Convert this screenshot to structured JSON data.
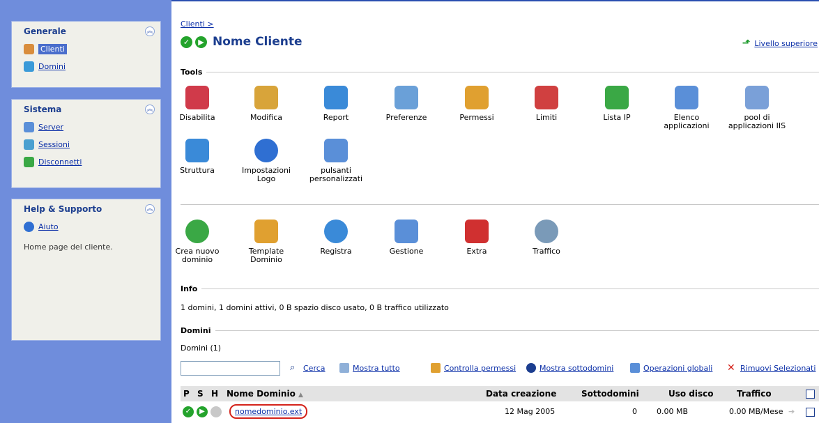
{
  "sidebar": {
    "generale": {
      "title": "Generale",
      "items": [
        {
          "label": "Clienti",
          "icon": "user-icon",
          "color": "#d98d3c"
        },
        {
          "label": "Domini",
          "icon": "domain-icon",
          "color": "#3a9ad8"
        }
      ]
    },
    "sistema": {
      "title": "Sistema",
      "items": [
        {
          "label": "Server",
          "icon": "server-icon",
          "color": "#5a8fd8"
        },
        {
          "label": "Sessioni",
          "icon": "sessions-icon",
          "color": "#4aa0d0"
        },
        {
          "label": "Disconnetti",
          "icon": "logout-icon",
          "color": "#3aa845"
        }
      ]
    },
    "help": {
      "title": "Help & Supporto",
      "items": [
        {
          "label": "Aiuto",
          "icon": "help-icon",
          "color": "#2f6fd2"
        }
      ],
      "description": "Home page del cliente."
    }
  },
  "main": {
    "breadcrumb": "Clienti >",
    "title": "Nome Cliente",
    "up_level": "Livello superiore",
    "tools_title": "Tools",
    "tools_row1": [
      {
        "label": "Disabilita",
        "icon": "disable-icon",
        "color": "#d03a4a"
      },
      {
        "label": "Modifica",
        "icon": "edit-icon",
        "color": "#d8a43a"
      },
      {
        "label": "Report",
        "icon": "report-icon",
        "color": "#3a8ad8"
      },
      {
        "label": "Preferenze",
        "icon": "preferences-icon",
        "color": "#6aa0d8"
      },
      {
        "label": "Permessi",
        "icon": "permissions-icon",
        "color": "#e0a030"
      },
      {
        "label": "Limiti",
        "icon": "limits-icon",
        "color": "#d04040"
      },
      {
        "label": "Lista IP",
        "icon": "ip-list-icon",
        "color": "#3aa845"
      },
      {
        "label": "Elenco applicazioni",
        "icon": "applications-icon",
        "color": "#5a8fd8"
      },
      {
        "label": "pool di applicazioni IIS",
        "icon": "iis-pool-icon",
        "color": "#7aa0d8"
      }
    ],
    "tools_row2": [
      {
        "label": "Struttura",
        "icon": "structure-icon",
        "color": "#3a8ad8"
      },
      {
        "label": "Impostazioni Logo",
        "icon": "logo-settings-icon",
        "color": "#2f6fd2"
      },
      {
        "label": "pulsanti personalizzati",
        "icon": "custom-buttons-icon",
        "color": "#5a8fd8"
      }
    ],
    "tools_row3": [
      {
        "label": "Crea nuovo dominio",
        "icon": "new-domain-icon",
        "color": "#3aa845"
      },
      {
        "label": "Template Dominio",
        "icon": "domain-template-icon",
        "color": "#e0a030"
      },
      {
        "label": "Registra",
        "icon": "register-icon",
        "color": "#3a8ad8"
      },
      {
        "label": "Gestione",
        "icon": "management-icon",
        "color": "#5a8fd8"
      },
      {
        "label": "Extra",
        "icon": "extra-icon",
        "color": "#d03030"
      },
      {
        "label": "Traffico",
        "icon": "traffic-icon",
        "color": "#7a9ab8"
      }
    ],
    "info_title": "Info",
    "info_text": "1 domini, 1 domini attivi, 0 B spazio disco usato, 0 B traffico utilizzato",
    "domini_title": "Domini",
    "domini_count": "Domini (1)",
    "search": {
      "value": "",
      "cerca": "Cerca",
      "mostra_tutto": "Mostra tutto",
      "controlla_permessi": "Controlla permessi",
      "mostra_sottodomini": "Mostra sottodomini",
      "operazioni_globali": "Operazioni globali",
      "rimuovi": "Rimuovi Selezionati"
    },
    "table": {
      "headers": {
        "p": "P",
        "s": "S",
        "h": "H",
        "nome": "Nome Dominio",
        "data": "Data creazione",
        "sottodomini": "Sottodomini",
        "uso_disco": "Uso disco",
        "traffico": "Traffico"
      },
      "rows": [
        {
          "nome": "nomedominio.ext",
          "data": "12 Mag 2005",
          "sottodomini": "0",
          "uso_disco": "0.00 MB",
          "traffico": "0.00 MB/Mese"
        }
      ]
    }
  },
  "colors": {
    "sidebar_bg": "#6f8ddc",
    "title": "#1c3e8f",
    "status_green": "#24a32c",
    "highlight_red": "#d4231b"
  }
}
